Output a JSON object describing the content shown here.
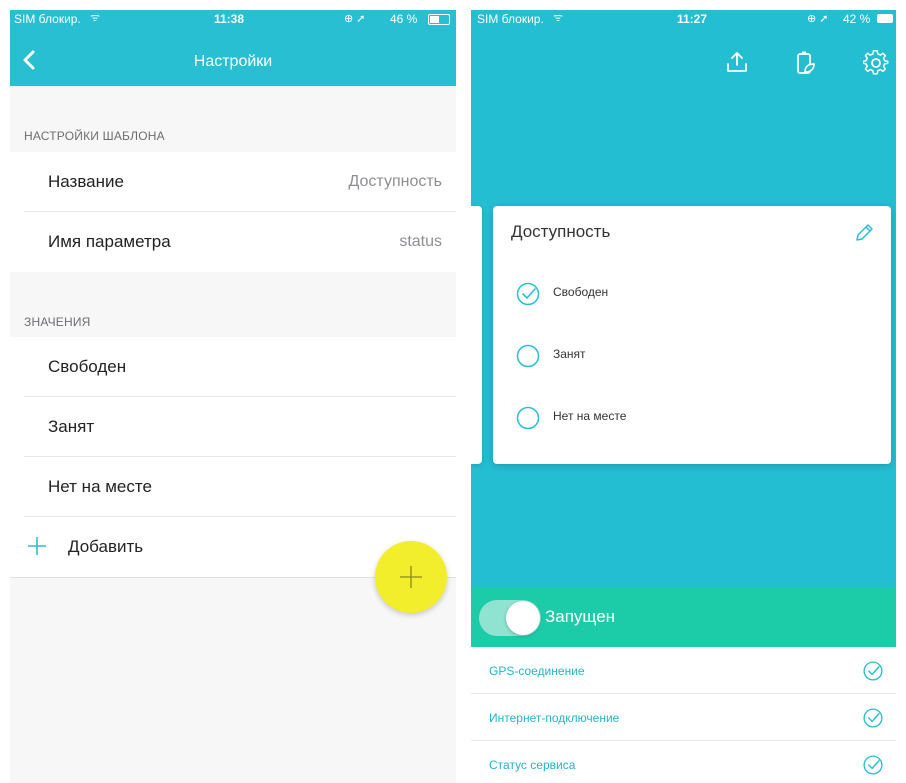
{
  "left": {
    "status_bar": {
      "carrier": "SIM блокир.",
      "time": "11:38",
      "battery": "46 %"
    },
    "nav": {
      "title": "Настройки",
      "back_icon": "chevron-left-icon"
    },
    "template_section": {
      "header": "НАСТРОЙКИ ШАБЛОНА",
      "rows": [
        {
          "label": "Название",
          "value": "Доступность"
        },
        {
          "label": "Имя параметра",
          "value": "status"
        }
      ]
    },
    "values_section": {
      "header": "ЗНАЧЕНИЯ",
      "items": [
        "Свободен",
        "Занят",
        "Нет на месте"
      ],
      "add_label": "Добавить"
    }
  },
  "right": {
    "status_bar": {
      "carrier": "SIM блокир.",
      "time": "11:27",
      "battery": "42 %"
    },
    "toolbar_icons": [
      "upload-icon",
      "battery-leaf-icon",
      "gear-icon"
    ],
    "card": {
      "title": "Доступность",
      "edit_icon": "pencil-icon",
      "options": [
        {
          "label": "Свободен",
          "selected": true
        },
        {
          "label": "Занят",
          "selected": false
        },
        {
          "label": "Нет на месте",
          "selected": false
        }
      ]
    },
    "run_toggle": {
      "label": "Запущен",
      "on": true
    },
    "status_items": [
      {
        "label": "GPS-соединение",
        "ok": true
      },
      {
        "label": "Интернет-подключение",
        "ok": true
      },
      {
        "label": "Статус сервиса",
        "ok": true
      }
    ],
    "fab_icon": "plus-icon"
  },
  "colors": {
    "primary": "#29bfd2",
    "panel": "#24bed3",
    "run_bar": "#1ccca9",
    "fab": "#f3ee2b",
    "link": "#26b3c9"
  }
}
